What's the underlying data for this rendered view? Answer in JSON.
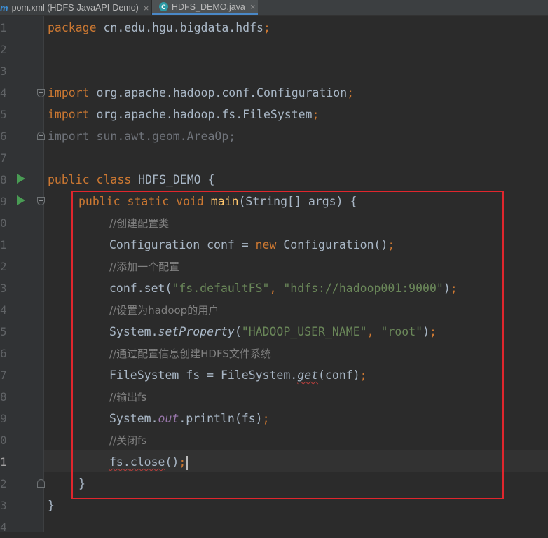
{
  "tabs": [
    {
      "icon": "m",
      "label": "pom.xml (HDFS-JavaAPI-Demo)",
      "active": false
    },
    {
      "icon": "C",
      "label": "HDFS_DEMO.java",
      "active": true
    }
  ],
  "close_glyph": "×",
  "line_numbers": [
    "1",
    "2",
    "3",
    "4",
    "5",
    "6",
    "7",
    "8",
    "9",
    "0",
    "1",
    "2",
    "3",
    "4",
    "5",
    "6",
    "7",
    "8",
    "9",
    "0",
    "1",
    "2",
    "3",
    "4"
  ],
  "code": {
    "l1_pkg": "package",
    "l1_rest": " cn.edu.hgu.bigdata.hdfs",
    "semi": ";",
    "import_kw": "import",
    "l4_rest": " org.apache.hadoop.conf.Configuration",
    "l5_rest": " org.apache.hadoop.fs.FileSystem",
    "l6_rest": "import sun.awt.geom.AreaOp;",
    "public_kw": "public",
    "class_kw": " class",
    "class_name": " HDFS_DEMO {",
    "static_kw": " static",
    "void_kw": " void",
    "main_name": " main",
    "main_params": "(String[] args) {",
    "c1": "//创建配置类",
    "l11_a": "Configuration conf = ",
    "new_kw": "new",
    "l11_b": " Configuration()",
    "c2": "//添加一个配置",
    "l13_a": "conf.set(",
    "s_defaultfs": "\"fs.defaultFS\"",
    "comma": ", ",
    "s_hdfsurl": "\"hdfs://hadoop001:9000\"",
    "close_paren": ")",
    "c3": "//设置为hadoop的用户",
    "l15_a": "System.",
    "set_property": "setProperty",
    "open_paren": "(",
    "s_user_key": "\"HADOOP_USER_NAME\"",
    "s_root": "\"root\"",
    "c4": "//通过配置信息创建HDFS文件系统",
    "l17_a": "FileSystem fs = FileSystem.",
    "get_fn": "get",
    "l17_b": "(conf)",
    "c5": "//输出fs",
    "l19_a": "System.",
    "out_field": "out",
    "l19_b": ".println(fs)",
    "c6": "//关闭fs",
    "l21_fs": "fs.",
    "l21_close": "close",
    "l21_b": "()",
    "brace_close": "}"
  }
}
